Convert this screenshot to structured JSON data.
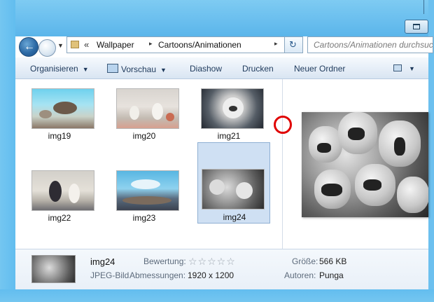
{
  "nav": {
    "back_icon": "back-arrow-icon",
    "forward_icon": "forward-arrow-icon",
    "history_icon": "chevron-down-icon"
  },
  "address": {
    "overflow": "«",
    "crumbs": [
      "Wallpaper",
      "Cartoons/Animationen"
    ],
    "separator": "▸",
    "dropdown": "▼",
    "refresh": "↻"
  },
  "search": {
    "placeholder": "Cartoons/Animationen durchsuchen"
  },
  "toolbar": {
    "organize": "Organisieren",
    "preview": "Vorschau",
    "slideshow": "Diashow",
    "print": "Drucken",
    "new_folder": "Neuer Ordner",
    "dropdown": "▼"
  },
  "files": [
    {
      "name": "img19"
    },
    {
      "name": "img20"
    },
    {
      "name": "img21"
    },
    {
      "name": "img22"
    },
    {
      "name": "img23"
    },
    {
      "name": "img24",
      "selected": true
    }
  ],
  "details": {
    "name": "img24",
    "type": "JPEG-Bild",
    "rating_label": "Bewertung:",
    "rating_stars": "☆☆☆☆☆",
    "rating": 0,
    "dimensions_label": "Abmessungen:",
    "dimensions": "1920 x 1200",
    "size_label": "Größe:",
    "size": "566 KB",
    "authors_label": "Autoren:",
    "authors": "Punga"
  },
  "colors": {
    "frame": "#6cc0ef",
    "selection": "#cfe0f3",
    "highlight_circle": "#e00000"
  }
}
